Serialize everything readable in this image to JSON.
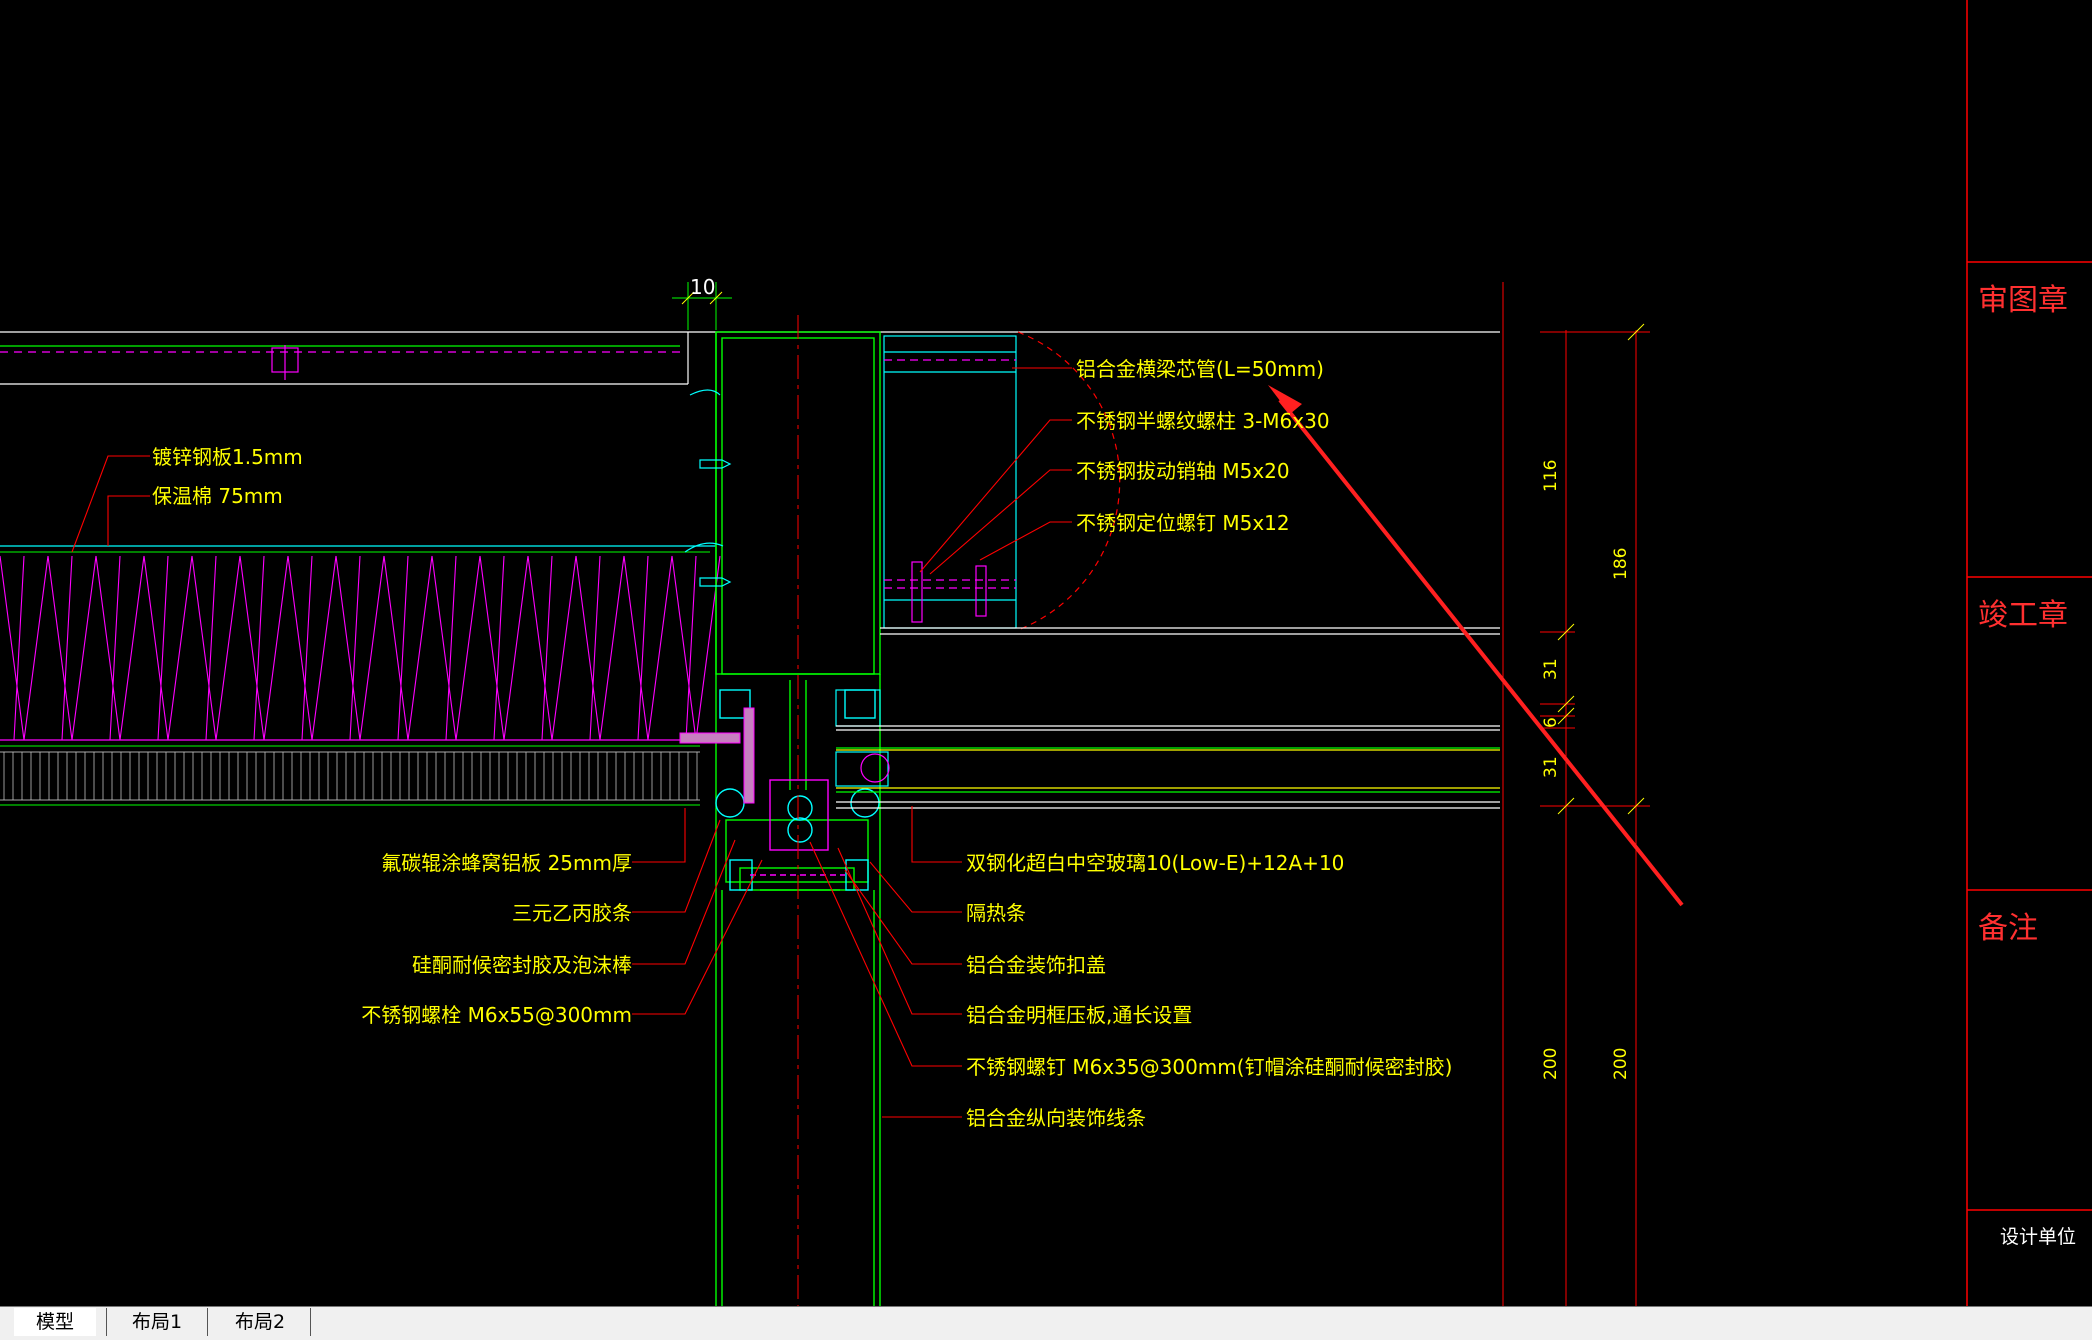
{
  "colors": {
    "background": "#000000",
    "yellow": "#ffff00",
    "green": "#00ff00",
    "magenta": "#ff00ff",
    "red": "#ff0000",
    "cyan": "#00ffff",
    "white": "#ffffff"
  },
  "dimension_top": "10",
  "labels_right": [
    "铝合金横梁芯管(L=50mm)",
    "不锈钢半螺纹螺柱 3-M6x30",
    "不锈钢拔动销轴 M5x20",
    "不锈钢定位螺钉 M5x12"
  ],
  "labels_left_top": [
    "镀锌钢板1.5mm",
    "保温棉 75mm"
  ],
  "labels_left_bottom": [
    "氟碳辊涂蜂窝铝板 25mm厚",
    "三元乙丙胶条",
    "硅酮耐候密封胶及泡沫棒",
    "不锈钢螺栓 M6x55@300mm"
  ],
  "labels_right_bottom": [
    "双钢化超白中空玻璃10(Low-E)+12A+10",
    "隔热条",
    "铝合金装饰扣盖",
    "铝合金明框压板,通长设置",
    "不锈钢螺钉 M6x35@300mm(钉帽涂硅酮耐候密封胶)",
    "铝合金纵向装饰线条"
  ],
  "dims_inner": [
    "116",
    "31",
    "6",
    "31",
    "200"
  ],
  "dims_outer": [
    "186",
    "200"
  ],
  "title_block": {
    "review_stamp": "审图章",
    "completion_stamp": "竣工章",
    "remarks": "备注",
    "design_unit": "设计单位"
  },
  "tabs": [
    "模型",
    "布局1",
    "布局2"
  ]
}
